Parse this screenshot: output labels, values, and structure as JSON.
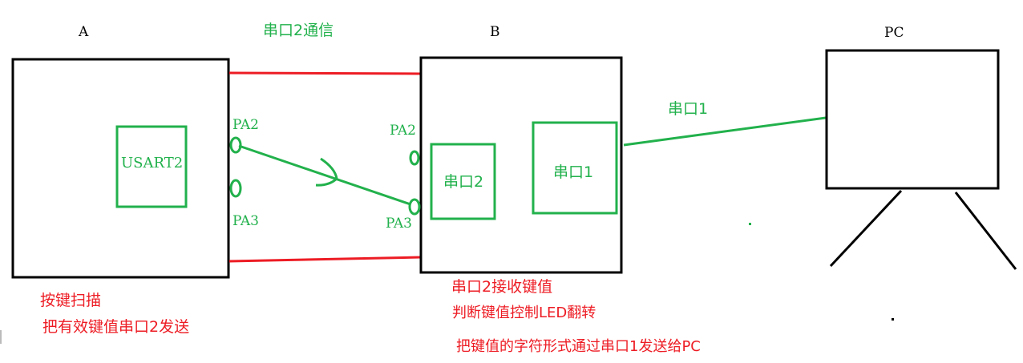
{
  "colors": {
    "ink": "#000000",
    "green": "#22b14c",
    "red": "#ed1c24"
  },
  "board_a": {
    "title": "A",
    "module": "USART2",
    "pin_top": "PA2",
    "pin_bottom": "PA3",
    "notes": [
      "按键扫描",
      "把有效键值串口2发送"
    ]
  },
  "link_ab": {
    "label": "串口2通信"
  },
  "board_b": {
    "title": "B",
    "pin_top": "PA2",
    "pin_bottom": "PA3",
    "box_left": "串口2",
    "box_right": "串口1",
    "notes": [
      "串口2接收键值",
      "判断键值控制LED翻转",
      "把键值的字符形式通过串口1发送给PC"
    ]
  },
  "link_b_pc": {
    "label": "串口1"
  },
  "pc": {
    "title": "PC"
  }
}
